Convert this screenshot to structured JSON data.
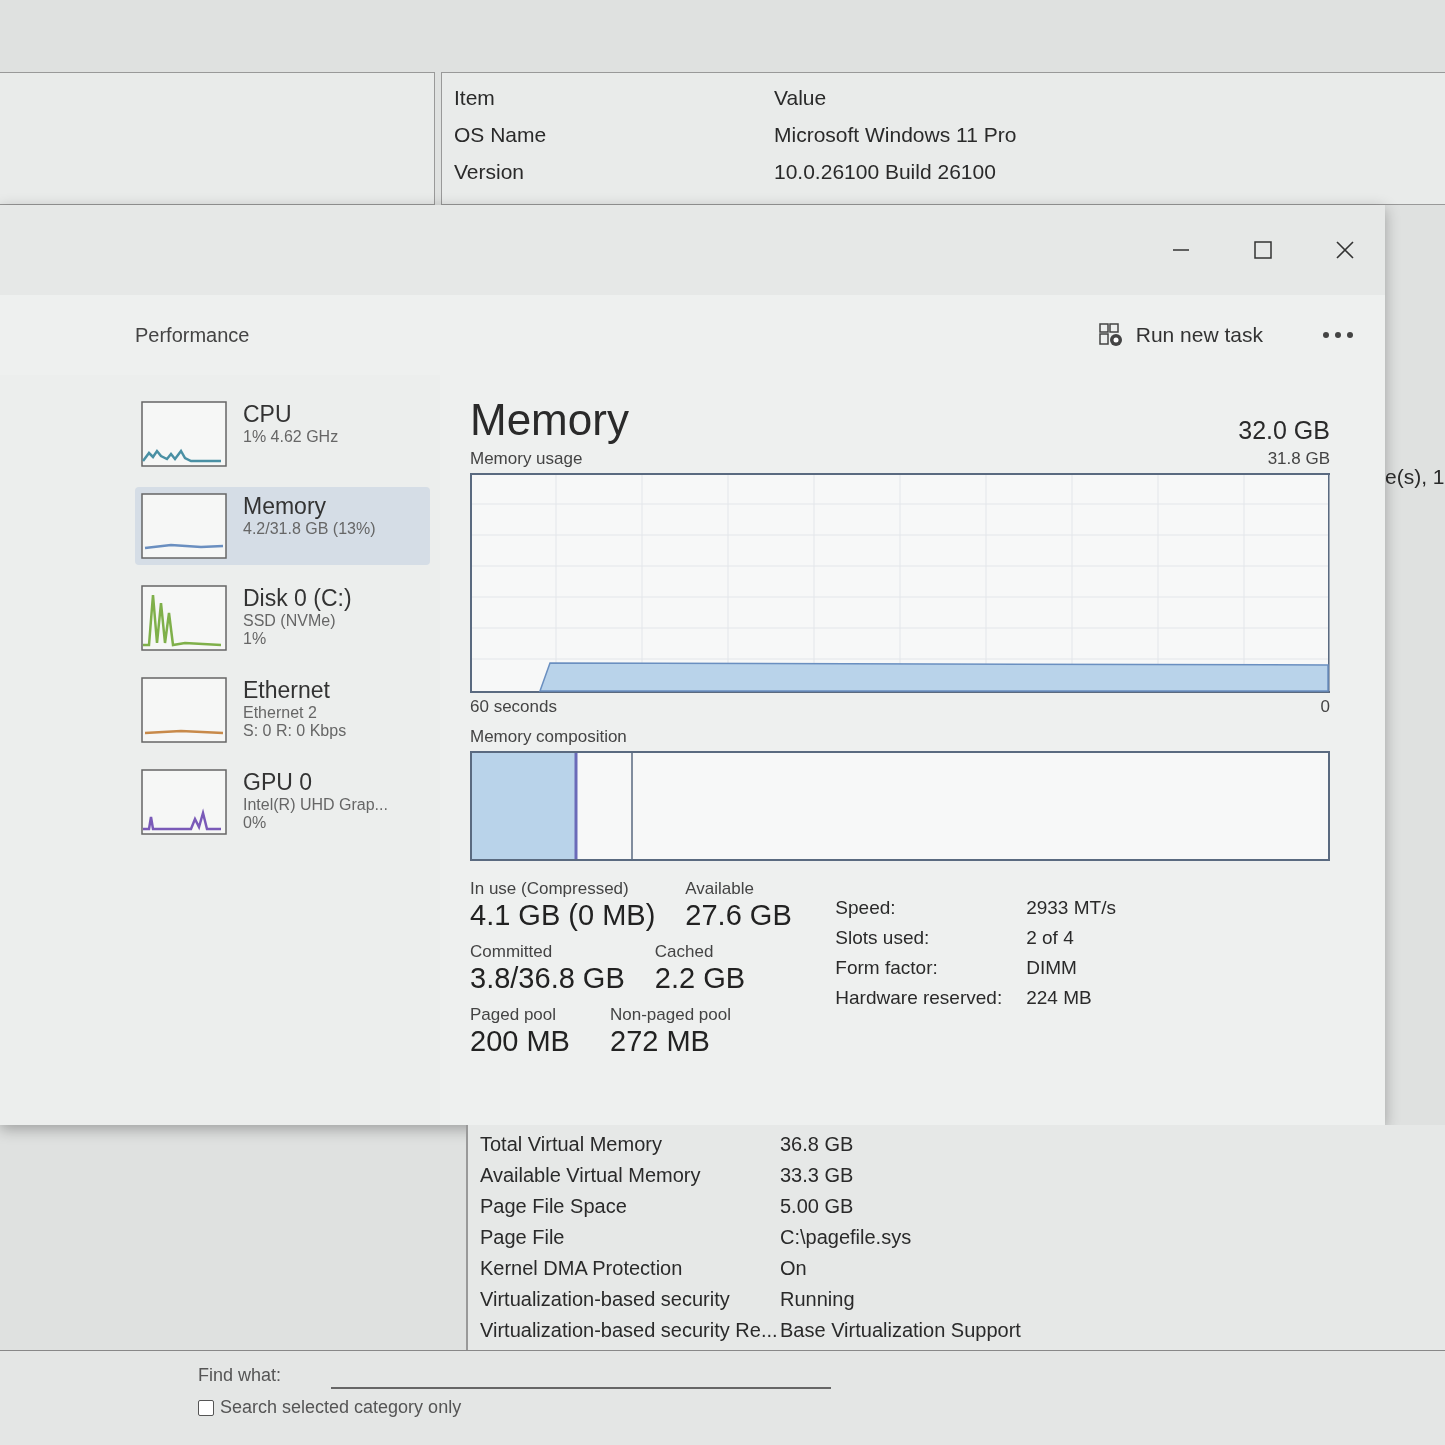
{
  "background_window": {
    "table": {
      "columns": [
        "Item",
        "Value"
      ],
      "rows": [
        [
          "OS Name",
          "Microsoft Windows 11 Pro"
        ],
        [
          "Version",
          "10.0.26100 Build 26100"
        ]
      ]
    },
    "side_fragment": "e(s), 1",
    "lower_rows": [
      [
        "Total Virtual Memory",
        "36.8 GB"
      ],
      [
        "Available Virtual Memory",
        "33.3 GB"
      ],
      [
        "Page File Space",
        "5.00 GB"
      ],
      [
        "Page File",
        "C:\\pagefile.sys"
      ],
      [
        "Kernel DMA Protection",
        "On"
      ],
      [
        "Virtualization-based security",
        "Running"
      ],
      [
        "Virtualization-based security Re...",
        "Base Virtualization Support"
      ]
    ],
    "find": {
      "label": "Find what:",
      "checkbox": {
        "label": "Search selected category only",
        "checked": false
      }
    }
  },
  "task_manager": {
    "page_title": "Performance",
    "run_new_task": "Run new task",
    "sidebar": [
      {
        "kind": "cpu",
        "name": "CPU",
        "details": [
          "1% 4.62 GHz"
        ],
        "color": "#4a90a4",
        "selected": false
      },
      {
        "kind": "memory",
        "name": "Memory",
        "details": [
          "4.2/31.8 GB (13%)"
        ],
        "color": "#6a8fc0",
        "selected": true
      },
      {
        "kind": "disk",
        "name": "Disk 0 (C:)",
        "details": [
          "SSD (NVMe)",
          "1%"
        ],
        "color": "#7fb04a",
        "selected": false
      },
      {
        "kind": "ethernet",
        "name": "Ethernet",
        "details": [
          "Ethernet 2",
          "S: 0 R: 0 Kbps"
        ],
        "color": "#c88a4a",
        "selected": false
      },
      {
        "kind": "gpu",
        "name": "GPU 0",
        "details": [
          "Intel(R) UHD Grap...",
          "0%"
        ],
        "color": "#7a5ab8",
        "selected": false
      }
    ],
    "detail": {
      "title": "Memory",
      "total": "32.0 GB",
      "usage_label": "Memory usage",
      "usage_max": "31.8 GB",
      "time_span": "60 seconds",
      "usage_min": "0",
      "composition_label": "Memory composition",
      "stats": [
        {
          "label": "In use (Compressed)",
          "value": "4.1 GB (0 MB)"
        },
        {
          "label": "Available",
          "value": "27.6 GB"
        },
        {
          "label": "Committed",
          "value": "3.8/36.8 GB"
        },
        {
          "label": "Cached",
          "value": "2.2 GB"
        },
        {
          "label": "Paged pool",
          "value": "200 MB"
        },
        {
          "label": "Non-paged pool",
          "value": "272 MB"
        }
      ],
      "specs": [
        {
          "label": "Speed:",
          "value": "2933 MT/s"
        },
        {
          "label": "Slots used:",
          "value": "2 of 4"
        },
        {
          "label": "Form factor:",
          "value": "DIMM"
        },
        {
          "label": "Hardware reserved:",
          "value": "224 MB"
        }
      ]
    }
  }
}
